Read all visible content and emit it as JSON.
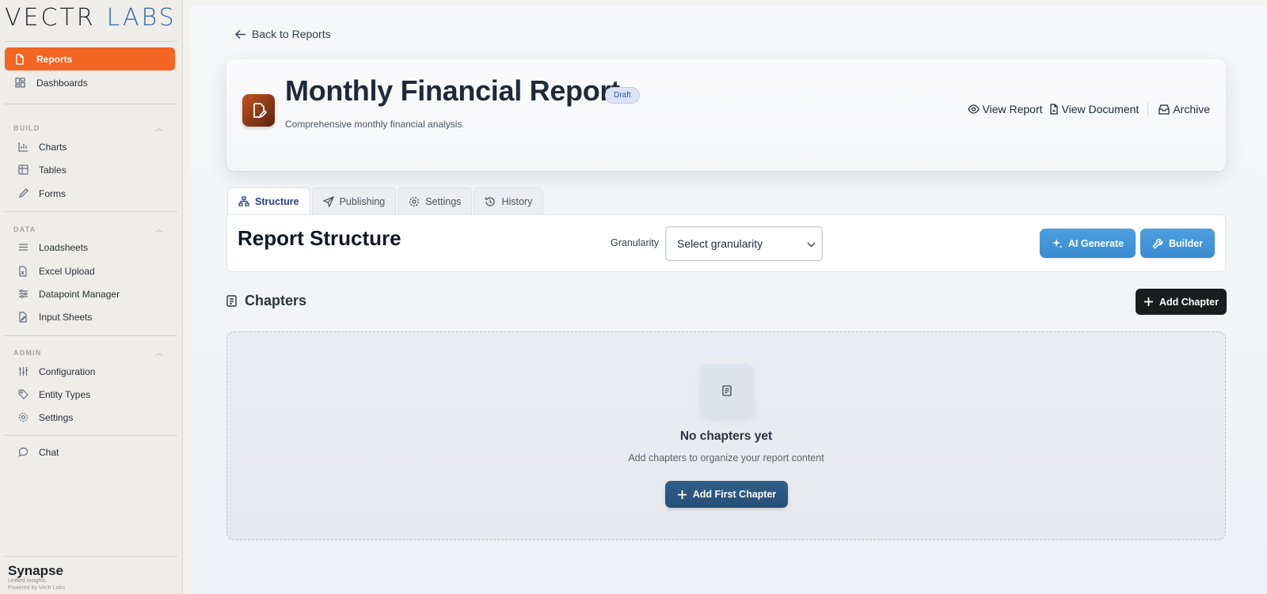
{
  "logo": {
    "part1": "VECTR",
    "part2": "LABS"
  },
  "sidebar": {
    "top_items": [
      {
        "label": "Reports",
        "icon": "file-icon",
        "active": true
      },
      {
        "label": "Dashboards",
        "icon": "dashboard-icon",
        "active": false
      }
    ],
    "sections": [
      {
        "label": "BUILD",
        "items": [
          {
            "label": "Charts",
            "icon": "bar-chart-icon"
          },
          {
            "label": "Tables",
            "icon": "table-icon"
          },
          {
            "label": "Forms",
            "icon": "pencil-icon"
          }
        ]
      },
      {
        "label": "DATA",
        "items": [
          {
            "label": "Loadsheets",
            "icon": "list-icon"
          },
          {
            "label": "Excel Upload",
            "icon": "spreadsheet-file-icon"
          },
          {
            "label": "Datapoint Manager",
            "icon": "sliders-icon"
          },
          {
            "label": "Input Sheets",
            "icon": "edit-file-icon"
          }
        ]
      },
      {
        "label": "ADMIN",
        "items": [
          {
            "label": "Configuration",
            "icon": "columns-sliders-icon"
          },
          {
            "label": "Entity Types",
            "icon": "tag-icon"
          },
          {
            "label": "Settings",
            "icon": "gear-icon"
          }
        ]
      }
    ],
    "chat": {
      "label": "Chat",
      "icon": "chat-icon"
    },
    "brand": {
      "name": "Synapse",
      "tagline": "Unified Insights",
      "powered": "Powered by Vectr Labs"
    }
  },
  "back_link": "Back to Reports",
  "report": {
    "title": "Monthly Financial Report",
    "status": "Draft",
    "description": "Comprehensive monthly financial analysis",
    "actions": {
      "view_report": "View Report",
      "view_document": "View Document",
      "archive": "Archive"
    }
  },
  "tabs": [
    {
      "label": "Structure",
      "icon": "hierarchy-icon",
      "active": true
    },
    {
      "label": "Publishing",
      "icon": "send-icon",
      "active": false
    },
    {
      "label": "Settings",
      "icon": "gear-icon",
      "active": false
    },
    {
      "label": "History",
      "icon": "history-icon",
      "active": false
    }
  ],
  "structure": {
    "title": "Report Structure",
    "granularity_label": "Granularity",
    "granularity_value": "Select granularity",
    "ai_generate": "AI Generate",
    "builder": "Builder"
  },
  "chapters": {
    "heading": "Chapters",
    "add_button": "Add Chapter",
    "empty_title": "No chapters yet",
    "empty_desc": "Add chapters to organize your report content",
    "add_first": "Add First Chapter"
  },
  "colors": {
    "accent": "#f26522",
    "blue": "#3a8cd0",
    "navy": "#254f76",
    "logo_blue": "#2f6aa3"
  }
}
